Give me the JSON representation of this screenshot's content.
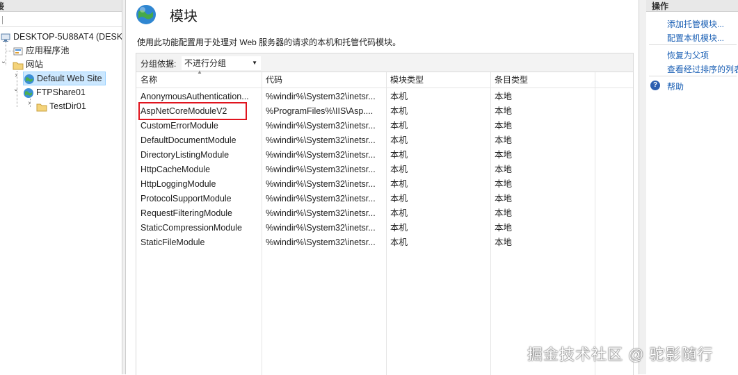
{
  "tree": {
    "header": "接",
    "items": [
      {
        "label": "DESKTOP-5U88AT4 (DESKT"
      },
      {
        "label": "应用程序池"
      },
      {
        "label": "网站"
      },
      {
        "label": "Default Web Site"
      },
      {
        "label": "FTPShare01"
      },
      {
        "label": "TestDir01"
      }
    ]
  },
  "page": {
    "title": "模块",
    "description": "使用此功能配置用于处理对 Web 服务器的请求的本机和托管代码模块。",
    "group_by_label": "分组依据:",
    "group_by_value": "不进行分组"
  },
  "table": {
    "columns": [
      "名称",
      "代码",
      "模块类型",
      "条目类型"
    ],
    "rows": [
      [
        "AnonymousAuthentication...",
        "%windir%\\System32\\inetsr...",
        "本机",
        "本地"
      ],
      [
        "AspNetCoreModuleV2",
        "%ProgramFiles%\\IIS\\Asp....",
        "本机",
        "本地"
      ],
      [
        "CustomErrorModule",
        "%windir%\\System32\\inetsr...",
        "本机",
        "本地"
      ],
      [
        "DefaultDocumentModule",
        "%windir%\\System32\\inetsr...",
        "本机",
        "本地"
      ],
      [
        "DirectoryListingModule",
        "%windir%\\System32\\inetsr...",
        "本机",
        "本地"
      ],
      [
        "HttpCacheModule",
        "%windir%\\System32\\inetsr...",
        "本机",
        "本地"
      ],
      [
        "HttpLoggingModule",
        "%windir%\\System32\\inetsr...",
        "本机",
        "本地"
      ],
      [
        "ProtocolSupportModule",
        "%windir%\\System32\\inetsr...",
        "本机",
        "本地"
      ],
      [
        "RequestFilteringModule",
        "%windir%\\System32\\inetsr...",
        "本机",
        "本地"
      ],
      [
        "StaticCompressionModule",
        "%windir%\\System32\\inetsr...",
        "本机",
        "本地"
      ],
      [
        "StaticFileModule",
        "%windir%\\System32\\inetsr...",
        "本机",
        "本地"
      ]
    ]
  },
  "actions": {
    "header": "操作",
    "add_managed": "添加托管模块...",
    "configure_native": "配置本机模块...",
    "revert_parent": "恢复为父项",
    "view_ordered": "查看经过排序的列表...",
    "help": "帮助"
  },
  "watermark": "掘金技术社区 @ 驼影随行",
  "colors": {
    "link": "#1a5fb4",
    "highlight": "#e0141e",
    "selection": "#cce8ff"
  }
}
